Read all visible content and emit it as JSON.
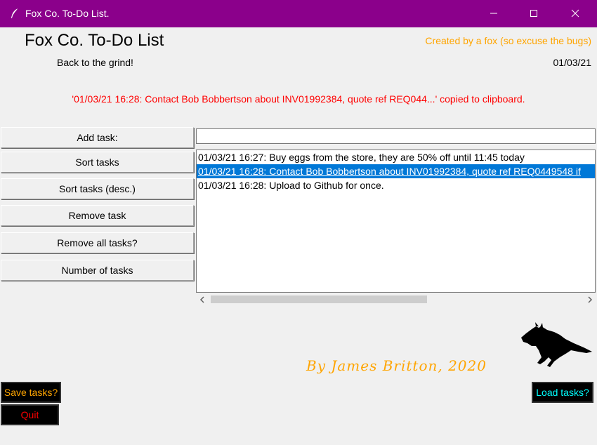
{
  "window": {
    "title": "Fox Co. To-Do List.",
    "app_icon": "feather-icon",
    "controls": [
      "minimize-icon",
      "maximize-icon",
      "close-icon"
    ]
  },
  "header": {
    "title": "Fox Co. To-Do List",
    "tagline": "Back to the grind!",
    "credit": "Created by a fox (so excuse the bugs)",
    "date": "01/03/21"
  },
  "status": "'01/03/21 16:28:  Contact Bob Bobbertson about INV01992384, quote ref REQ044...' copied to clipboard.",
  "buttons": {
    "add_task": "Add task:",
    "sort_tasks": "Sort tasks",
    "sort_desc": "Sort tasks (desc.)",
    "remove_task": "Remove task",
    "remove_all": "Remove all tasks?",
    "count_tasks": "Number of tasks",
    "save": "Save tasks?",
    "quit": "Quit",
    "load": "Load tasks?"
  },
  "task_input": {
    "value": "",
    "placeholder": ""
  },
  "tasks": [
    {
      "text": "01/03/21 16:27:  Buy eggs from the store, they are 50% off until 11:45 today",
      "selected": false
    },
    {
      "text": "01/03/21 16:28:  Contact Bob Bobbertson about INV01992384, quote ref REQ0449548 if",
      "selected": true
    },
    {
      "text": "01/03/21 16:28:  Upload to Github for once.",
      "selected": false
    }
  ],
  "author": "By James Britton, 2020",
  "images": {
    "mascot": "fox-silhouette"
  },
  "colors": {
    "titlebar": "#8b008b",
    "accent_orange": "#ffa500",
    "status_red": "#ff0000",
    "selection": "#0078d7",
    "load_cyan": "#00ffff"
  }
}
